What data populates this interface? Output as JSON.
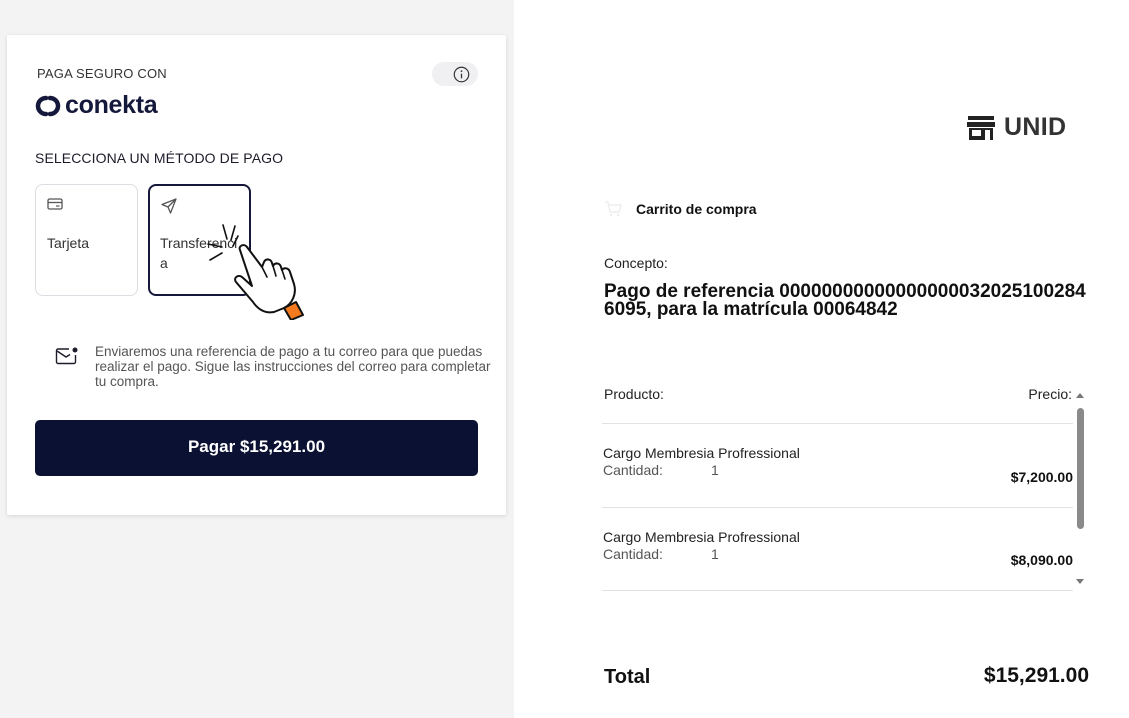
{
  "checkout": {
    "secure_label": "PAGA SEGURO CON",
    "brand": "conekta",
    "select_method_label": "SELECCIONA UN MÉTODO DE PAGO",
    "methods": [
      {
        "label": "Tarjeta",
        "icon": "credit-card-icon",
        "selected": false
      },
      {
        "label": "Transferencia",
        "icon": "send-icon",
        "selected": true
      }
    ],
    "notice": "Enviaremos una referencia de pago a tu correo para que puedas realizar el pago. Sigue las instrucciones del correo para completar tu compra.",
    "pay_button": "Pagar $15,291.00",
    "colors": {
      "primary": "#0b1132",
      "brand": "#14183a",
      "cursor_accent": "#f47a20"
    }
  },
  "summary": {
    "merchant": "UNID",
    "cart_title": "Carrito de compra",
    "concepto_label": "Concepto:",
    "concepto_value": "Pago de referencia 000000000000000000320251002846095, para la matrícula 00064842",
    "col_product": "Producto:",
    "col_price": "Precio:",
    "items": [
      {
        "name": "Cargo Membresia Profressional",
        "qty_label": "Cantidad:",
        "qty": "1",
        "price": "$7,200.00"
      },
      {
        "name": "Cargo Membresia Profressional",
        "qty_label": "Cantidad:",
        "qty": "1",
        "price": "$8,090.00"
      }
    ],
    "total_label": "Total",
    "total_value": "$15,291.00"
  }
}
